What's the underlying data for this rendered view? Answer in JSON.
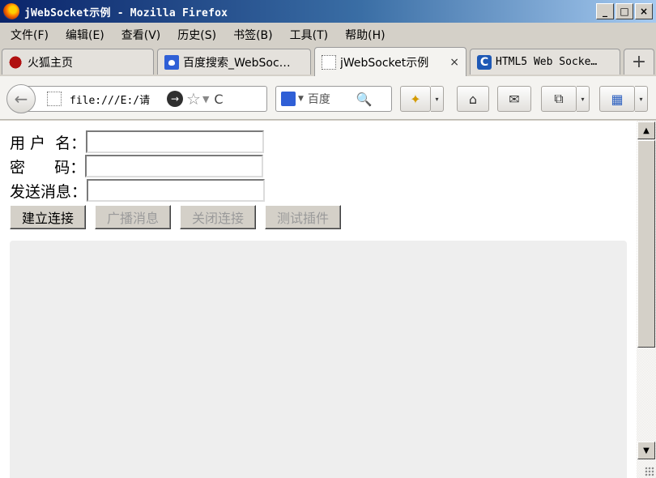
{
  "window": {
    "title": "jWebSocket示例 - Mozilla Firefox",
    "controls": {
      "minimize": "_",
      "maximize": "□",
      "close": "×"
    }
  },
  "menu": [
    "文件(F)",
    "编辑(E)",
    "查看(V)",
    "历史(S)",
    "书签(B)",
    "工具(T)",
    "帮助(H)"
  ],
  "tabs": [
    {
      "label": "火狐主页",
      "icon": "firefox-icon",
      "active": false
    },
    {
      "label": "百度搜索_WebSoc…",
      "icon": "baidu-paw-icon",
      "active": false
    },
    {
      "label": "jWebSocket示例",
      "icon": "page-icon",
      "active": true,
      "close": "×"
    },
    {
      "label": "HTML5 Web Socke…",
      "icon": "c-logo-icon",
      "active": false
    }
  ],
  "newtab_label": "+",
  "nav": {
    "back": "←",
    "url": "file:///E:/请",
    "go": "→",
    "star": "☆",
    "dropdown": "▼",
    "reload": "C",
    "search_placeholder": "百度",
    "search_icon_glyph": "🔍",
    "home": "⌂",
    "addon": "✦",
    "mail": "✉",
    "tools": "⧉",
    "grid": "▦",
    "drop_small": "▾"
  },
  "form": {
    "username_label": "用 户  名：",
    "password_label": "密      码：",
    "message_label": "发送消息：",
    "username_value": "",
    "password_value": "",
    "message_value": ""
  },
  "buttons": [
    {
      "label": "建立连接",
      "enabled": true
    },
    {
      "label": "广播消息",
      "enabled": false
    },
    {
      "label": "关闭连接",
      "enabled": false
    },
    {
      "label": "测试插件",
      "enabled": false
    }
  ],
  "scrollbar": {
    "up": "▲",
    "down": "▼"
  },
  "colors": {
    "titlebar_start": "#0a246a",
    "titlebar_end": "#a6caf0",
    "log_bg": "#eeeeee"
  }
}
